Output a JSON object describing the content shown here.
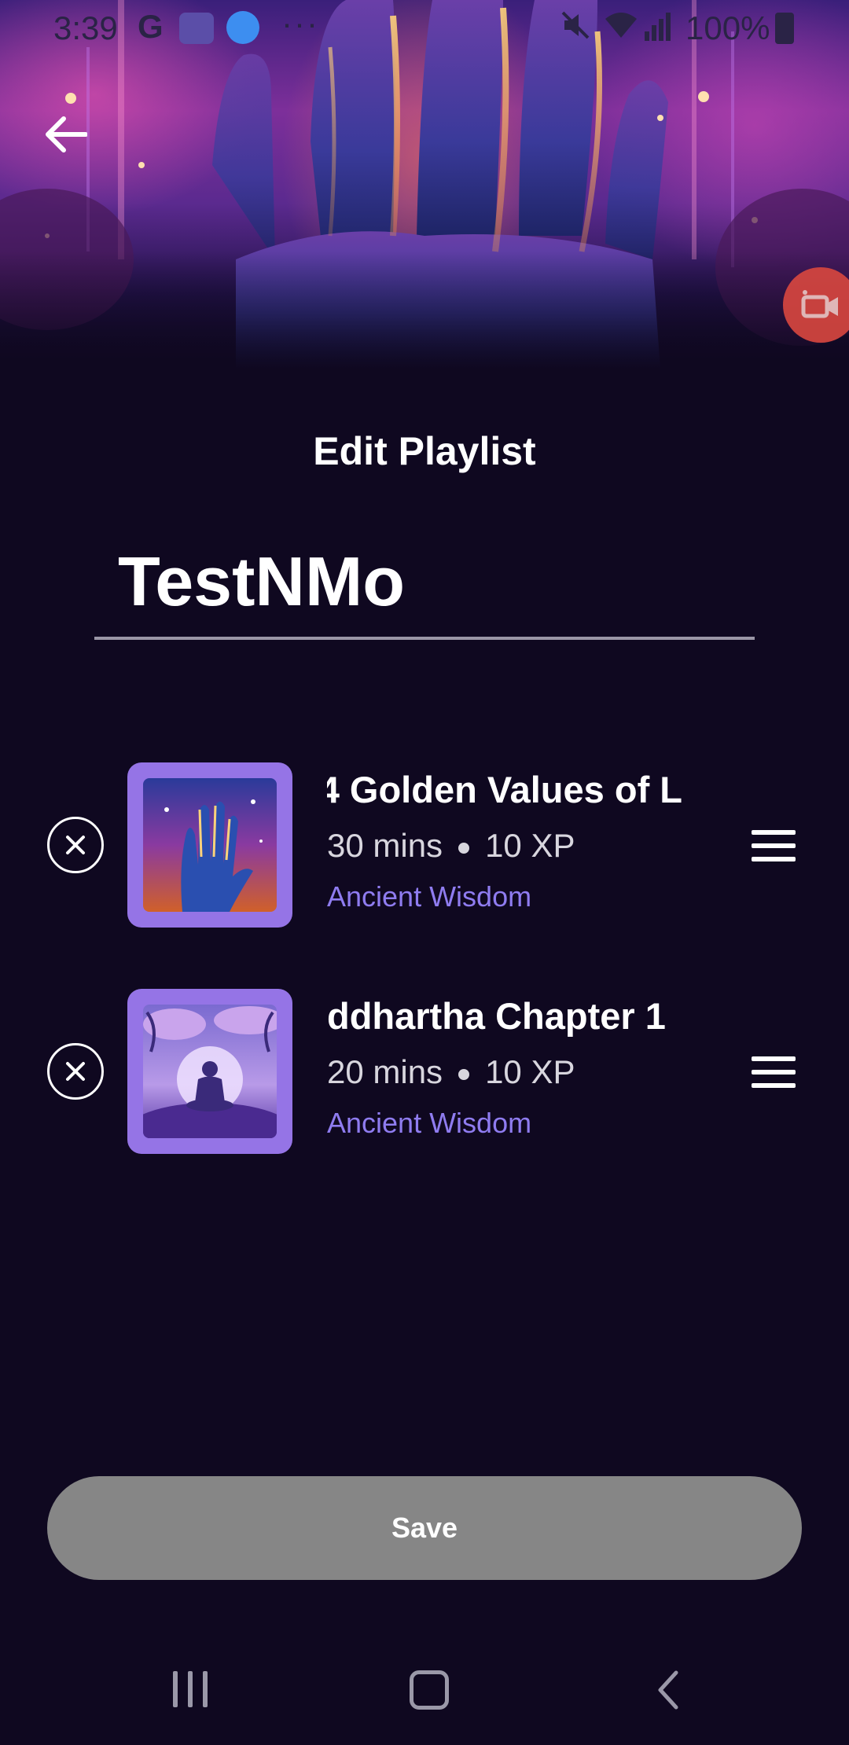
{
  "status_bar": {
    "time": "3:39",
    "google": "G",
    "dots": "···",
    "battery": "100%"
  },
  "header": {
    "back_icon": "arrow-left-icon",
    "record_icon": "video-camera-icon"
  },
  "page": {
    "title": "Edit Playlist",
    "playlist_name": "TestNMo"
  },
  "tracks": [
    {
      "title": "4 Golden Values of L",
      "duration": "30 mins",
      "xp": "10 XP",
      "category": "Ancient Wisdom",
      "thumb": "hand-artwork"
    },
    {
      "title": "ddhartha Chapter 1",
      "duration": "20 mins",
      "xp": "10 XP",
      "category": "Ancient Wisdom",
      "thumb": "meditation-artwork"
    }
  ],
  "actions": {
    "save_label": "Save"
  },
  "nav": {
    "recent_icon": "recent-apps-icon",
    "home_icon": "home-icon",
    "back_icon": "back-chevron-icon"
  },
  "colors": {
    "background": "#0f0820",
    "accent": "#8f7cf0",
    "thumb_frame": "#9574e6",
    "save_button": "#868686",
    "record_button": "#d9473f"
  }
}
